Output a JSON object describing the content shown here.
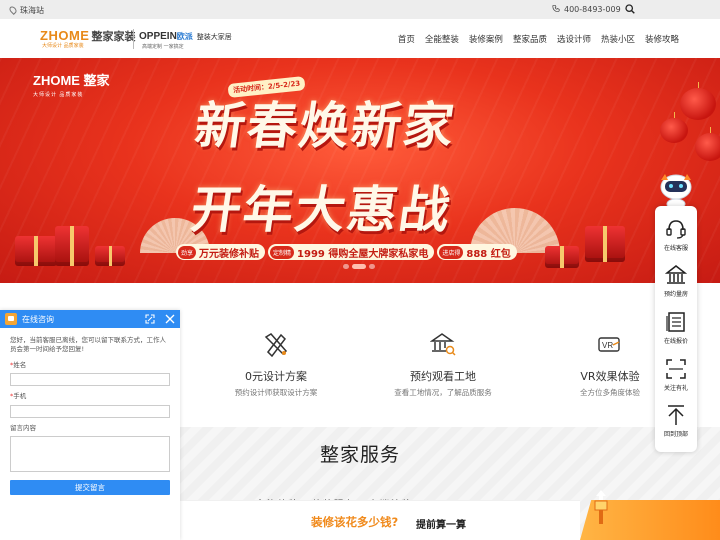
{
  "topbar": {
    "location": "珠海站",
    "phone": "400-8493-009"
  },
  "header": {
    "logo_brand": "ZHOME",
    "logo_brand_cn": "整家家装",
    "logo_tagline": "大师设计  品质家装",
    "partner_name": "OPPEIN",
    "partner_cn": "欧派",
    "partner_slogan": "整装大家居",
    "partner_sub": "高端定制  一家搞定",
    "nav": [
      "首页",
      "全能整装",
      "装修案例",
      "整家品质",
      "选设计师",
      "热装小区",
      "装修攻略"
    ]
  },
  "banner": {
    "logo": "ZHOME 整家",
    "logo_tagline": "大师设计  品质家装",
    "date": "活动时间：2/5-2/23",
    "headline_1": "新春焕新家",
    "headline_2": "开年大惠战",
    "promos": [
      {
        "tag": "劲享",
        "text": "万元装修补贴"
      },
      {
        "tag": "定制精",
        "text": "1999 得购全屋大牌家私家电"
      },
      {
        "tag": "进店得",
        "text": "888 红包"
      }
    ],
    "slide_count": 3,
    "active_slide": 2
  },
  "services": [
    {
      "title": "0元设计方案",
      "desc": "预约设计师获取设计方案",
      "icon": "design-icon"
    },
    {
      "title": "预约观看工地",
      "desc": "查看工地情况，了解品质服务",
      "icon": "site-icon"
    },
    {
      "title": "VR效果体验",
      "desc": "全方位多角度体验",
      "icon": "vr-icon"
    }
  ],
  "section": {
    "title": "整家服务",
    "peek": "全能整装 · 整装服务 · 高端精装"
  },
  "cost": {
    "question": "装修该花多少钱?",
    "button": "提前算一算"
  },
  "sidebar": [
    {
      "label": "在线客服",
      "icon": "headset-icon"
    },
    {
      "label": "预约量房",
      "icon": "house-icon"
    },
    {
      "label": "在线报价",
      "icon": "document-icon"
    },
    {
      "label": "关注有礼",
      "icon": "qrcode-icon"
    },
    {
      "label": "回到顶部",
      "icon": "arrow-up-icon"
    }
  ],
  "chat": {
    "title": "在线咨询",
    "message": "您好，当前客服已离线，您可以留下联系方式，工作人员会第一时间给予您回复!",
    "fields": [
      {
        "label": "姓名",
        "required": true
      },
      {
        "label": "手机",
        "required": true
      },
      {
        "label": "留言内容",
        "required": false
      }
    ],
    "submit": "提交留言"
  },
  "colors": {
    "brand_orange": "#e88a1a",
    "banner_red": "#e9331d",
    "chat_blue": "#2f8cf3"
  }
}
